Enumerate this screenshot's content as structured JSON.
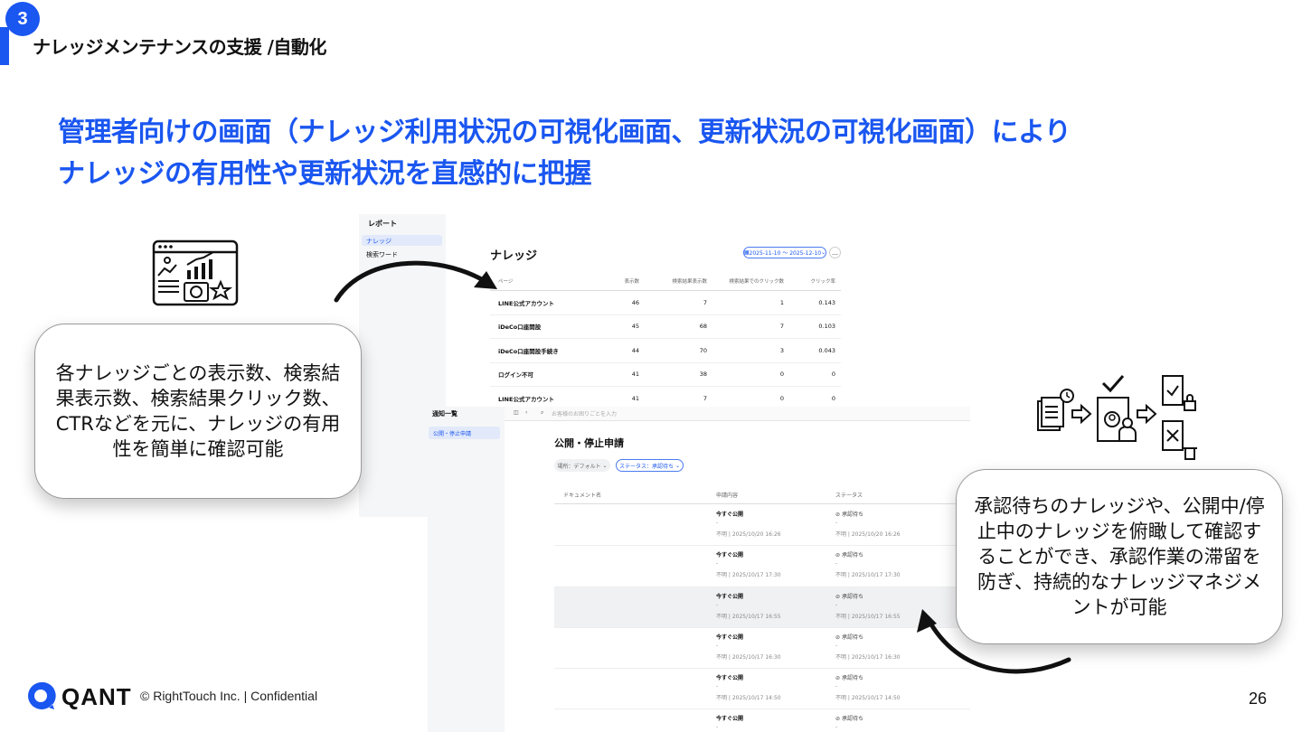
{
  "header": {
    "section_number": "3",
    "section_title": "ナレッジメンテナンスの支援 /自動化"
  },
  "headline": {
    "line1": "管理者向けの画面（ナレッジ利用状況の可視化画面、更新状況の可視化画面）により",
    "line2": "ナレッジの有用性や更新状況を直感的に把握"
  },
  "callouts": {
    "left": "各ナレッジごとの表示数、検索結果表示数、検索結果クリック数、CTRなどを元に、ナレッジの有用性を簡単に確認可能",
    "right": "承認待ちのナレッジや、公開中/停止中のナレッジを俯瞰して確認することができ、承認作業の滞留を防ぎ、持続的なナレッジマネジメントが可能"
  },
  "report_screen": {
    "sidebar_heading": "レポート",
    "sidebar_items": [
      "ナレッジ",
      "検索ワード"
    ],
    "title": "ナレッジ",
    "date_range": "2025-11-10 〜 2025-12-10",
    "more_label": "…",
    "columns": [
      "ページ",
      "表示数",
      "検索結果表示数",
      "検索結果でのクリック数",
      "クリック率"
    ],
    "rows": [
      {
        "page": "LINE公式アカウント",
        "views": "46",
        "search_views": "7",
        "clicks": "1",
        "ctr": "0.143"
      },
      {
        "page": "iDeCo口座開設",
        "views": "45",
        "search_views": "68",
        "clicks": "7",
        "ctr": "0.103"
      },
      {
        "page": "iDeCo口座開設手続き",
        "views": "44",
        "search_views": "70",
        "clicks": "3",
        "ctr": "0.043"
      },
      {
        "page": "ログイン不可",
        "views": "41",
        "search_views": "38",
        "clicks": "0",
        "ctr": "0"
      },
      {
        "page": "LINE公式アカウント",
        "views": "41",
        "search_views": "7",
        "clicks": "0",
        "ctr": "0"
      }
    ]
  },
  "notify_screen": {
    "sidebar_heading": "通知一覧",
    "sidebar_item": "公開・停止申請",
    "search_placeholder": "お客様のお困りごとを入力",
    "title": "公開・停止申請",
    "filter_location": "場所：デフォルト",
    "filter_status": "ステータス：承認待ち",
    "columns": [
      "ドキュメント名",
      "申請内容",
      "ステータス"
    ],
    "rows": [
      {
        "request": "今すぐ公開",
        "dash": "-",
        "time": "不明 | 2025/10/20 16:26",
        "status": "承認待ち",
        "status_time": "不明 | 2025/10/20 16:26"
      },
      {
        "request": "今すぐ公開",
        "dash": "-",
        "time": "不明 | 2025/10/17 17:30",
        "status": "承認待ち",
        "status_time": "不明 | 2025/10/17 17:30"
      },
      {
        "request": "今すぐ公開",
        "dash": "-",
        "time": "不明 | 2025/10/17 16:55",
        "status": "承認待ち",
        "status_time": "不明 | 2025/10/17 16:55"
      },
      {
        "request": "今すぐ公開",
        "dash": "-",
        "time": "不明 | 2025/10/17 16:30",
        "status": "承認待ち",
        "status_time": "不明 | 2025/10/17 16:30"
      },
      {
        "request": "今すぐ公開",
        "dash": "-",
        "time": "不明 | 2025/10/17 14:50",
        "status": "承認待ち",
        "status_time": "不明 | 2025/10/17 14:50"
      },
      {
        "request": "今すぐ公開",
        "dash": "-",
        "time": "",
        "status": "承認待ち",
        "status_time": ""
      }
    ]
  },
  "footer": {
    "logo_text": "QANT",
    "copyright": "© RightTouch Inc.  |  Confidential",
    "page_number": "26"
  },
  "colors": {
    "accent": "#1a56f0",
    "highlight_row": "#f0f1f3"
  },
  "icons": [
    "dashboard-analytics-icon",
    "approval-workflow-icon",
    "arrow-curved-icon"
  ]
}
